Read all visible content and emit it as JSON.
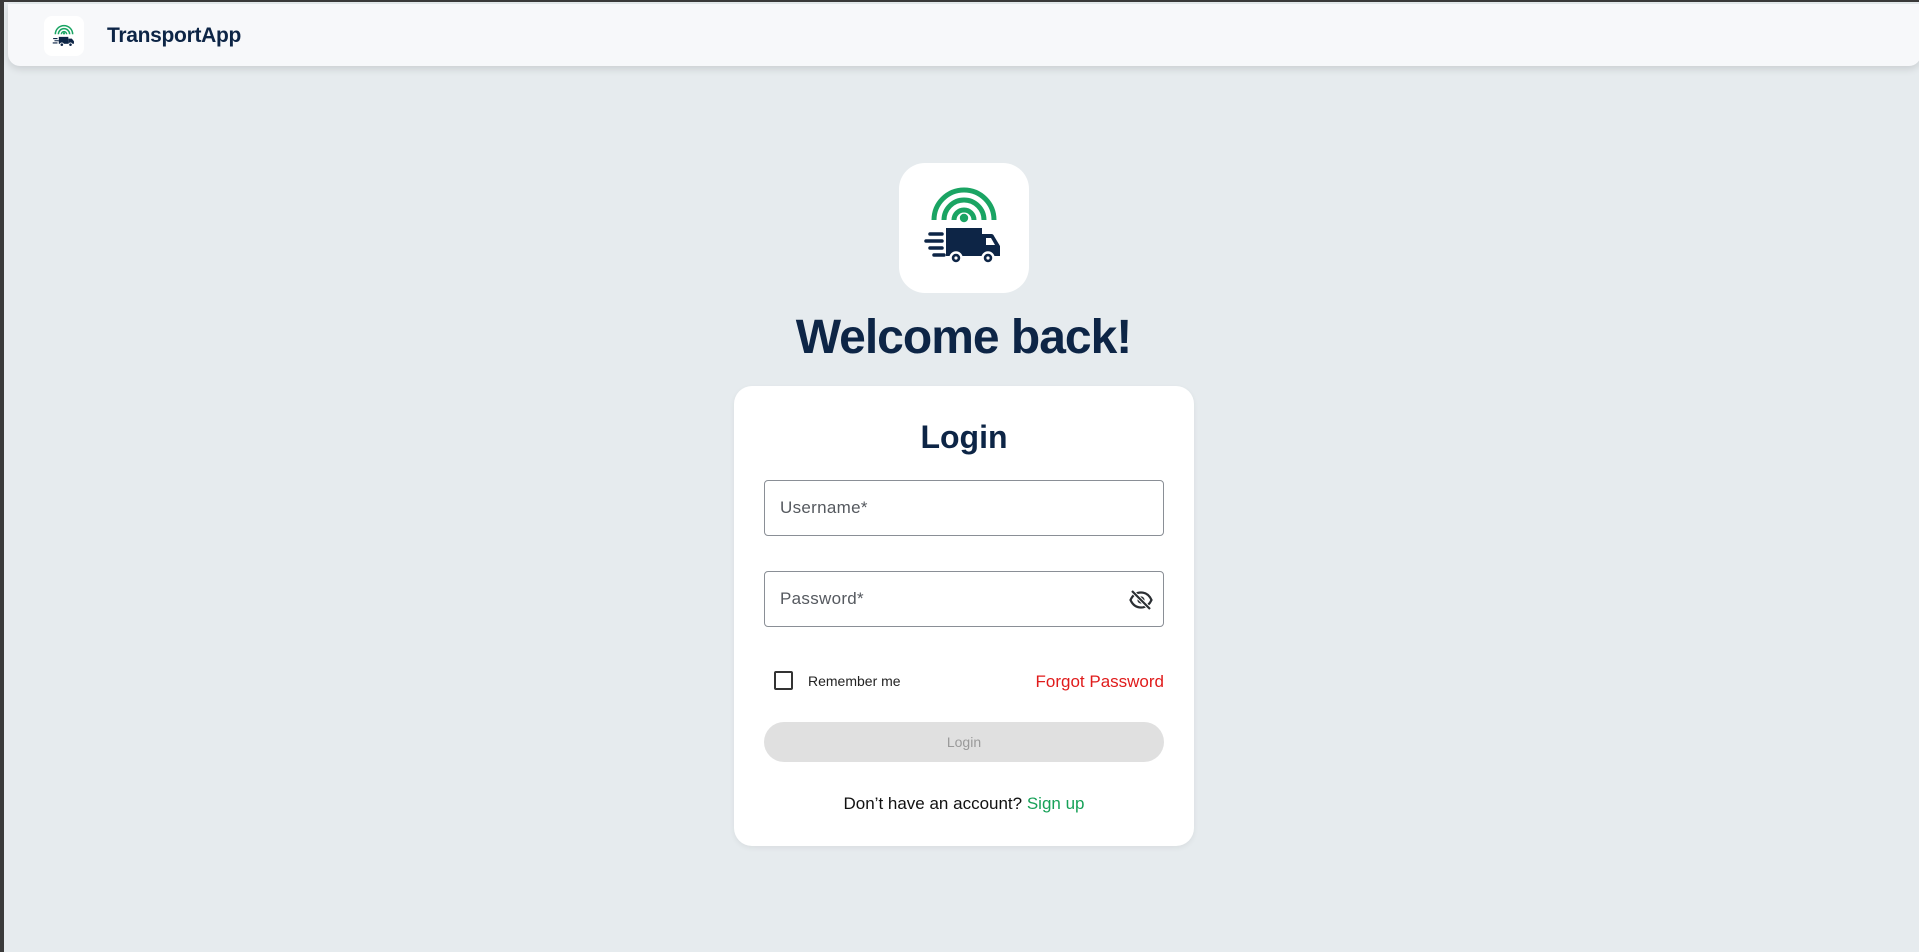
{
  "header": {
    "app_name": "TransportApp",
    "logo_icon": "truck-signal-icon"
  },
  "hero": {
    "logo_icon": "truck-signal-icon",
    "welcome": "Welcome back!"
  },
  "login_form": {
    "title": "Login",
    "username_placeholder": "Username*",
    "password_placeholder": "Password*",
    "password_visibility_icon": "eye-off-icon",
    "remember_label": "Remember me",
    "remember_checked": false,
    "forgot_label": "Forgot Password",
    "submit_label": "Login",
    "signup_prompt": "Don’t have an account?",
    "signup_label": "Sign up"
  },
  "colors": {
    "brand_navy": "#0d2546",
    "brand_green": "#17a158",
    "danger_red": "#e01b1b",
    "background": "#e6ebee"
  }
}
